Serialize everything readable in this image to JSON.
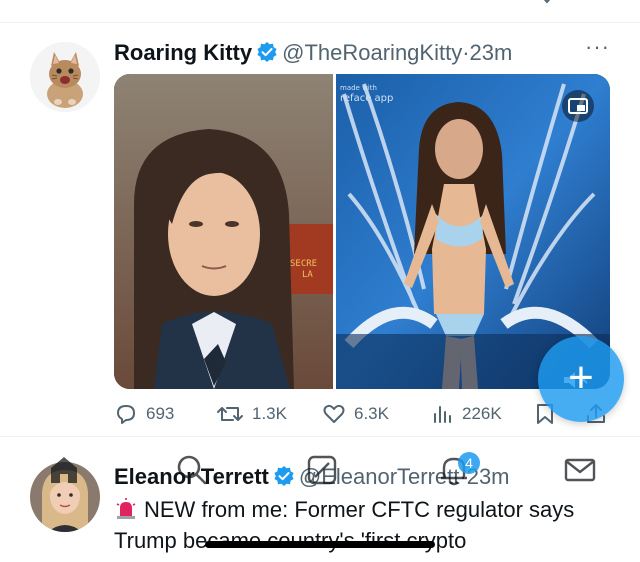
{
  "tweet1": {
    "author_name": "Roaring Kitty",
    "author_handle": "@TheRoaringKitty",
    "time": "23m",
    "more_label": "···",
    "media_overlay": {
      "watermark_line1": "made with",
      "watermark_line2": "reface app",
      "studio_sign_line1": "SECRE",
      "studio_sign_line2": "LA"
    },
    "actions": {
      "replies": "693",
      "reposts": "1.3K",
      "likes": "6.3K",
      "views": "226K"
    }
  },
  "tweet2": {
    "author_name": "Eleanor Terrett",
    "author_handle": "@EleanorTerrett",
    "time": "23m",
    "text": "NEW from me: Former CFTC regulator says Trump became country's 'first crypto"
  },
  "nav": {
    "notifications_badge": "4"
  },
  "fab_label": "+",
  "colors": {
    "accent": "#1d9bf0",
    "secondary_text": "#536471",
    "primary_text": "#0f1419"
  }
}
